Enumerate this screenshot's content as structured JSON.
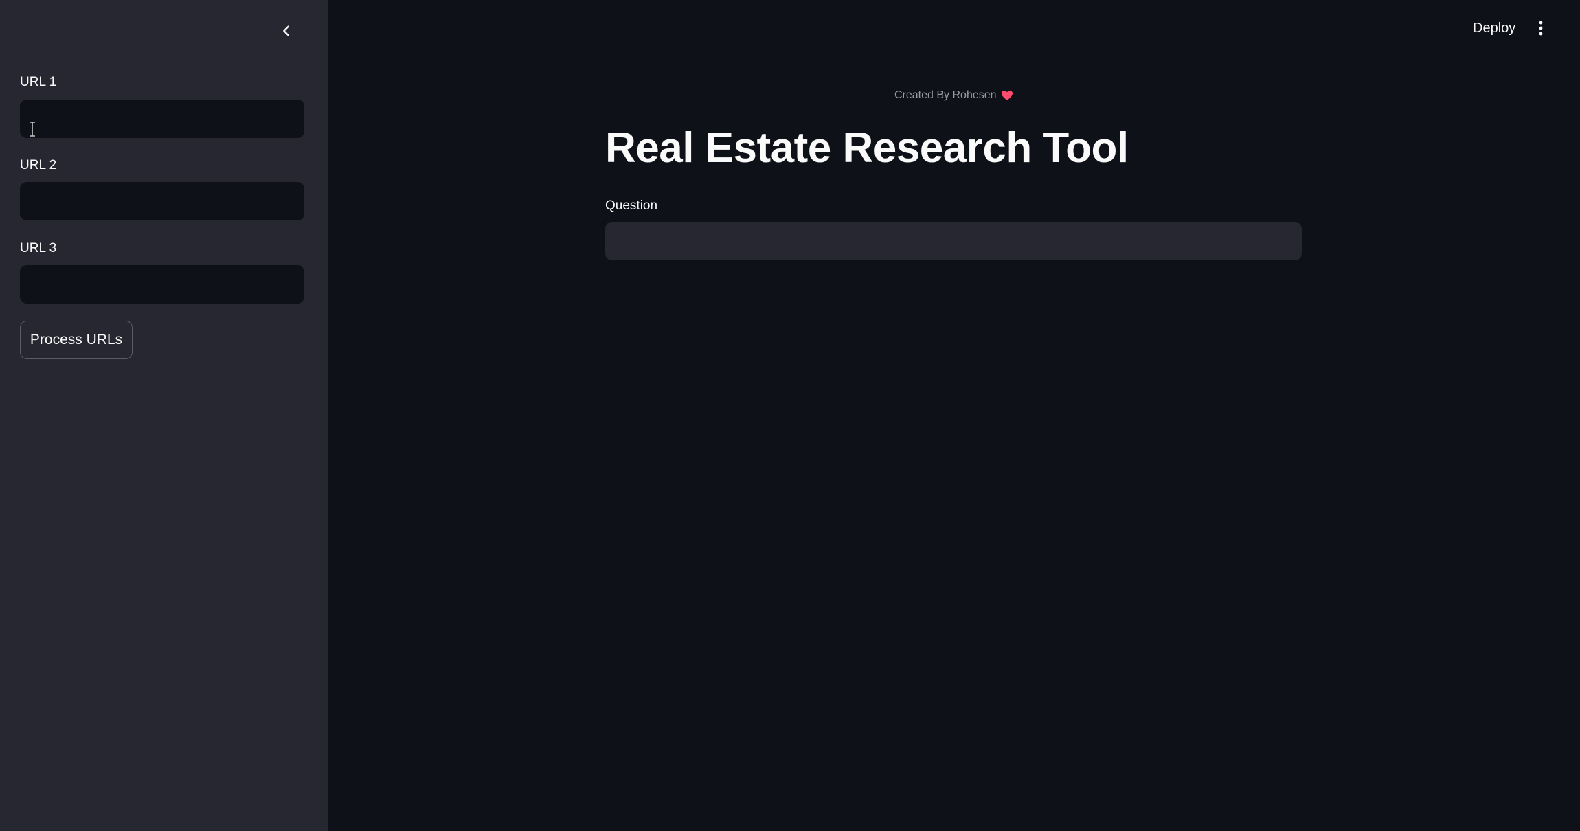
{
  "sidebar": {
    "collapse_icon": "chevron-left-icon",
    "fields": [
      {
        "label": "URL 1",
        "value": "",
        "placeholder": ""
      },
      {
        "label": "URL 2",
        "value": "",
        "placeholder": ""
      },
      {
        "label": "URL 3",
        "value": "",
        "placeholder": ""
      }
    ],
    "process_button_label": "Process URLs"
  },
  "header": {
    "deploy_label": "Deploy",
    "menu_icon": "vertical-ellipsis-icon"
  },
  "main": {
    "credit_text": "Created By Rohesen",
    "credit_icon": "heart-icon",
    "title": "Real Estate Research Tool",
    "question_label": "Question",
    "question_value": "",
    "question_placeholder": ""
  },
  "colors": {
    "background": "#0e1117",
    "sidebar": "#262730",
    "text": "#fafafa",
    "heart": "#ff4b6e"
  }
}
